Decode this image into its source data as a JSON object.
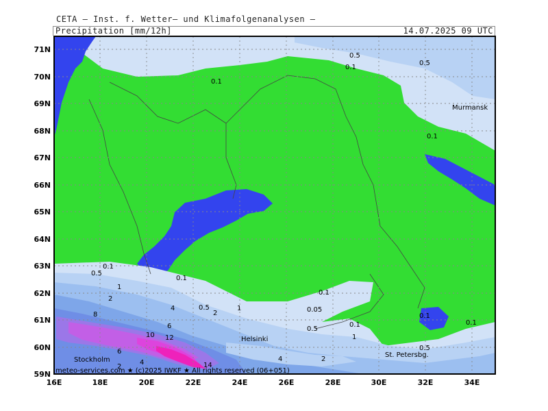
{
  "header": {
    "title": "CETA — Inst. f. Wetter— und Klimafolgenanalysen —",
    "subtitle": "Precipitation [mm/12h]",
    "timestamp": "14.07.2025 09 UTC"
  },
  "colors": {
    "dry_land": "#33dd33",
    "water": "#3344ee",
    "precip_0_1": "#d2e2f7",
    "precip_0_5": "#b8d2f4",
    "precip_1": "#9cbff0",
    "precip_2": "#7ea6e9",
    "precip_4": "#6f8ee6",
    "precip_6": "#9b77e8",
    "precip_8": "#c25fe6",
    "precip_10": "#dd44dd",
    "precip_12": "#ee22bb"
  },
  "axes": {
    "lat_labels": [
      "71N",
      "70N",
      "69N",
      "68N",
      "67N",
      "66N",
      "65N",
      "64N",
      "63N",
      "62N",
      "61N",
      "60N",
      "59N"
    ],
    "lon_labels": [
      "16E",
      "18E",
      "20E",
      "22E",
      "24E",
      "26E",
      "28E",
      "30E",
      "32E",
      "34E"
    ]
  },
  "cities": [
    "Murmansk",
    "Helsinki",
    "Stockholm",
    "St. Petersbg."
  ],
  "contour_labels": [
    "0.5",
    "0.1",
    "0.5",
    "0.1",
    "0.1",
    "0.1",
    "0.5",
    "0.1",
    "1",
    "2",
    "8",
    "6",
    "10",
    "12",
    "14",
    "2",
    "4",
    "4",
    "6",
    "4",
    "0.5",
    "2",
    "1",
    "0.1",
    "0.05",
    "0.1",
    "0.5",
    "1",
    "2",
    "0.1",
    "0.1",
    "0.5"
  ],
  "footer": {
    "credit": "meteo-services.com ★ (c)2025 IWKF ★ All rights reserved (06+051)"
  }
}
